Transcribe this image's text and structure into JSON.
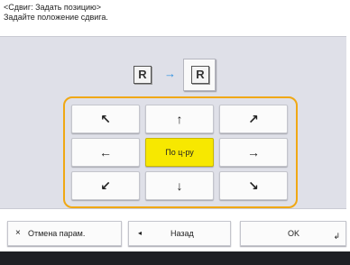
{
  "header": {
    "title": "<Сдвиг: Задать позицию>",
    "instruction": "Задайте положение сдвига."
  },
  "preview": {
    "source_letter": "R",
    "target_letter": "R",
    "arrow": "→",
    "arrow_color": "#2a8fe0"
  },
  "directions": {
    "up_left": "↖",
    "up": "↑",
    "up_right": "↗",
    "left": "←",
    "center": "По ц-ру",
    "right": "→",
    "down_left": "↙",
    "down": "↓",
    "down_right": "↘",
    "selected": "center",
    "selected_color": "#f7e800",
    "frame_color": "#f0a814"
  },
  "footer": {
    "cancel_label": "Отмена парам.",
    "cancel_icon": "×",
    "back_label": "Назад",
    "back_icon": "◂",
    "ok_label": "OK",
    "ok_icon": "↲"
  }
}
